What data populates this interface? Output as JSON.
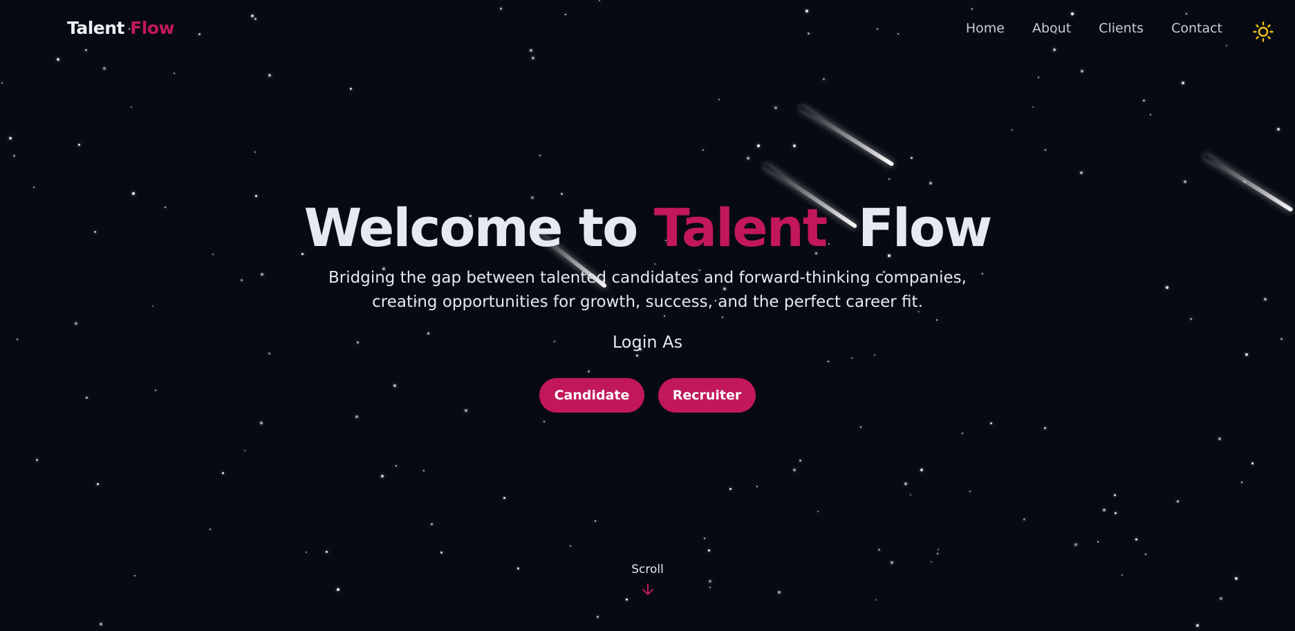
{
  "brand": {
    "first": "Talent",
    "second": "Flow"
  },
  "nav": {
    "items": [
      "Home",
      "About",
      "Clients",
      "Contact"
    ]
  },
  "theme_toggle": {
    "icon": "sun-icon",
    "color": "#f5c518"
  },
  "hero": {
    "title_part1": "Welcome to",
    "title_part2": "Talent",
    "title_part3": "Flow",
    "subtitle": "Bridging the gap between talented candidates and forward-thinking companies, creating opportunities for growth, success, and the perfect career fit.",
    "login_as": "Login As",
    "buttons": {
      "candidate": "Candidate",
      "recruiter": "Recruiter"
    }
  },
  "scroll": {
    "label": "Scroll",
    "icon": "arrow-down-icon"
  },
  "colors": {
    "accent": "#c2185b",
    "background": "#070a12",
    "text": "#e6e9f2"
  }
}
